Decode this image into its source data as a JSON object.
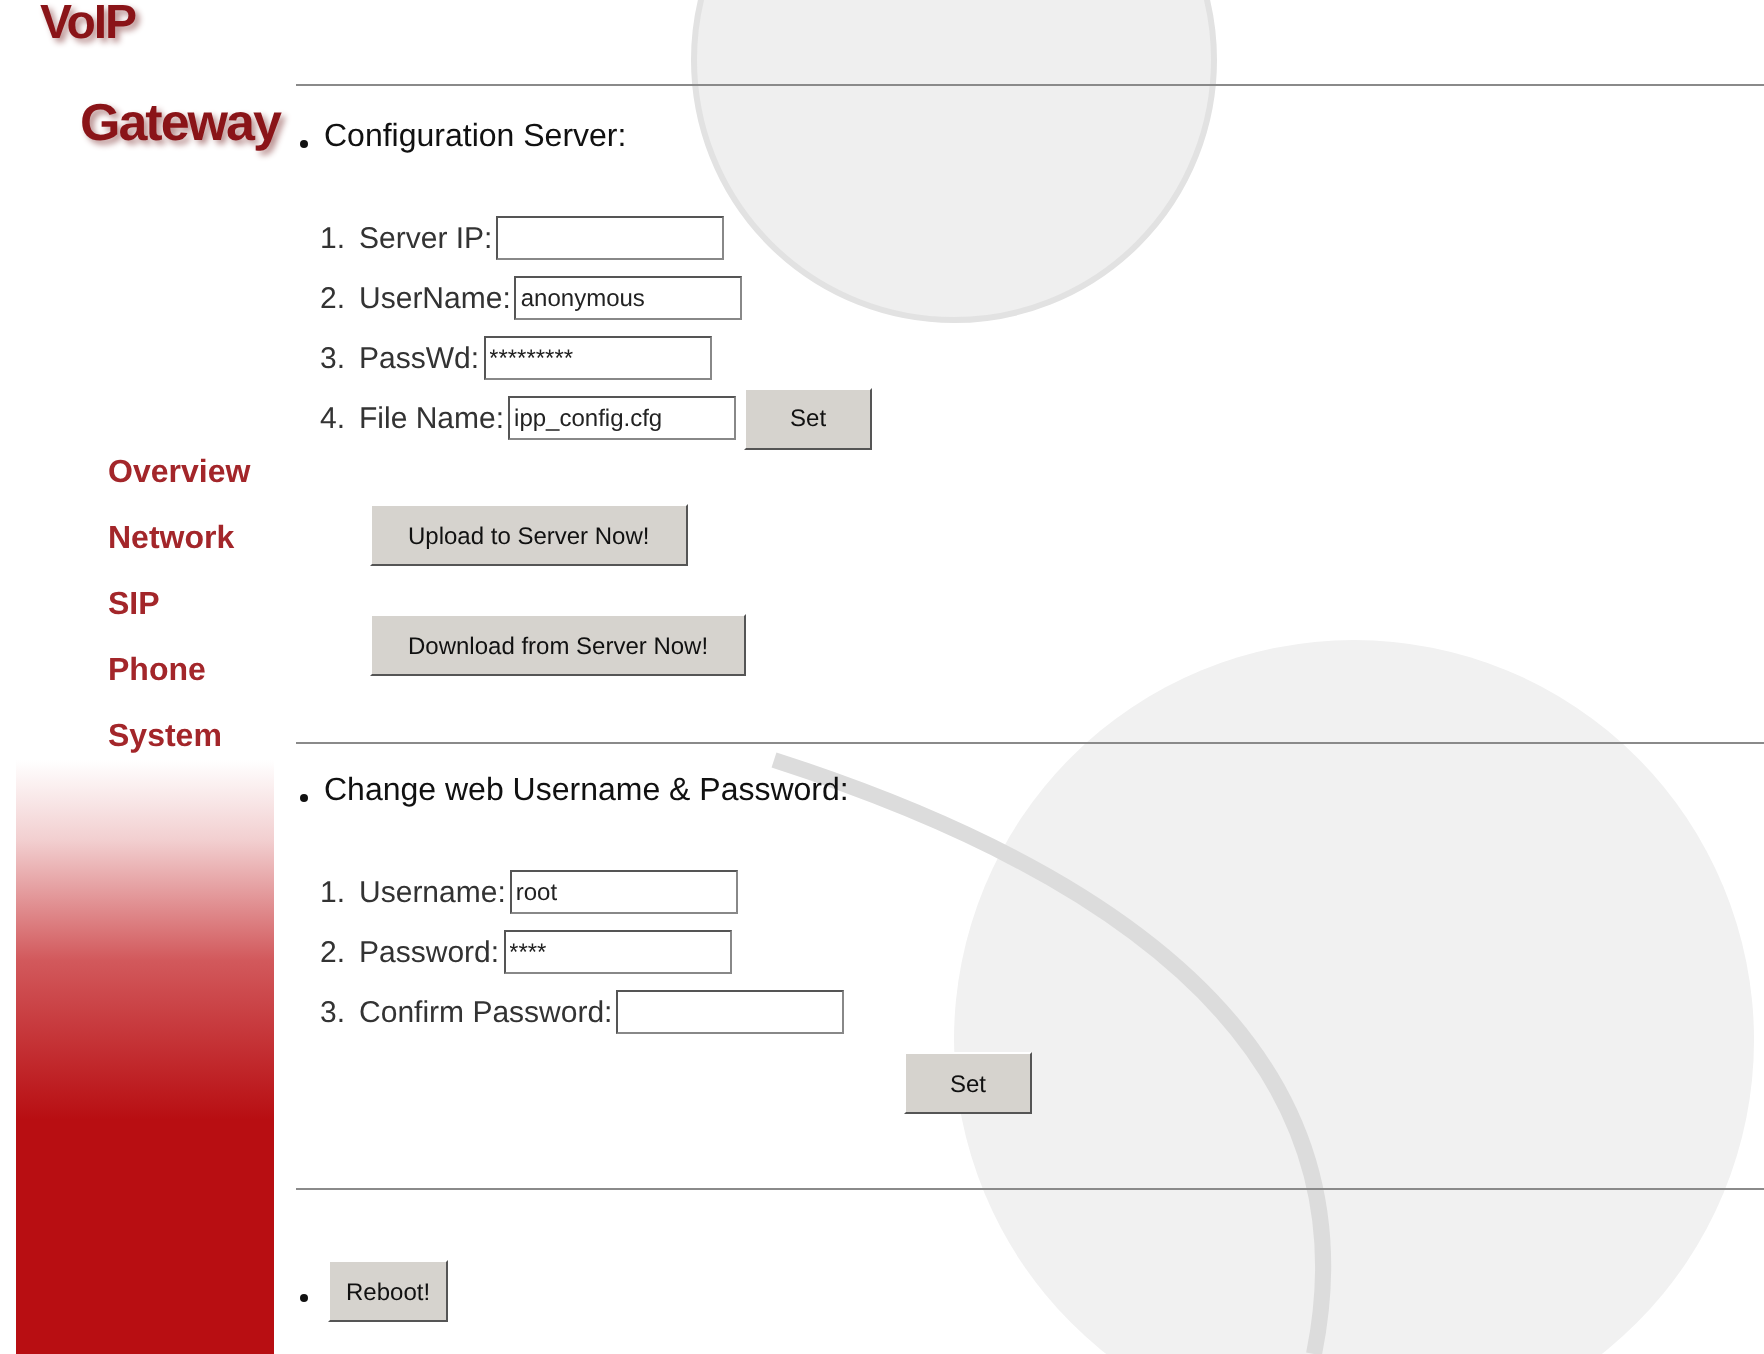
{
  "logo": {
    "lines": [
      "VoIP",
      "Gateway"
    ]
  },
  "nav": [
    {
      "label": "Overview"
    },
    {
      "label": "Network"
    },
    {
      "label": "SIP"
    },
    {
      "label": "Phone"
    },
    {
      "label": "System"
    }
  ],
  "sections": [
    {
      "kind": "form",
      "title": "Configuration Server:",
      "fields": [
        {
          "number": "1.",
          "label": "Server IP:"
        },
        {
          "number": "2.",
          "label": "UserName:",
          "value": "anonymous"
        },
        {
          "number": "3.",
          "label": "PassWd:",
          "value": "*********"
        },
        {
          "number": "4.",
          "label": "File Name:",
          "value": "ipp_config.cfg",
          "button": "Set"
        }
      ],
      "buttons": [
        "Upload to Server Now!",
        "Download from Server Now!"
      ]
    },
    {
      "kind": "form",
      "title": "Change web Username & Password:",
      "fields": [
        {
          "number": "1.",
          "label": "Username:",
          "value": "root"
        },
        {
          "number": "2.",
          "label": "Password:",
          "value": "****"
        },
        {
          "number": "3.",
          "label": "Confirm Password:"
        }
      ],
      "set_button": "Set"
    },
    {
      "kind": "action",
      "button": "Reboot!"
    }
  ]
}
